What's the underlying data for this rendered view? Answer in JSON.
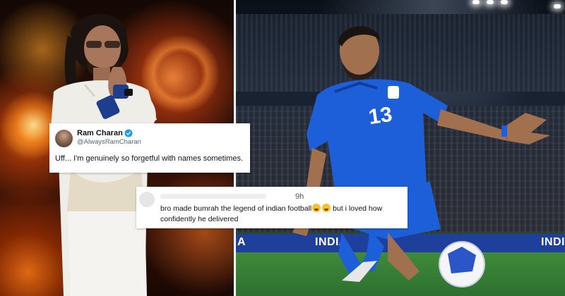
{
  "tweet": {
    "name": "Ram Charan",
    "handle": "@AlwaysRamCharan",
    "text": "Uff... I'm genuinely so forgetful with names sometimes.",
    "verified_color": "#1d9bf0"
  },
  "comment": {
    "time": "9h",
    "line1": "bro made bumrah the legend of indian football",
    "line2": "confidently he delivered",
    "line1_suffix": " but i loved how",
    "emojis": [
      "loudly-crying-face",
      "face-with-tears-of-joy"
    ]
  },
  "right_photo": {
    "jersey_number": "13",
    "banner_text": "INDIA",
    "banner_text_2": "INDI",
    "banner_left_text": "A",
    "jersey_color": "#1c5fd8"
  }
}
